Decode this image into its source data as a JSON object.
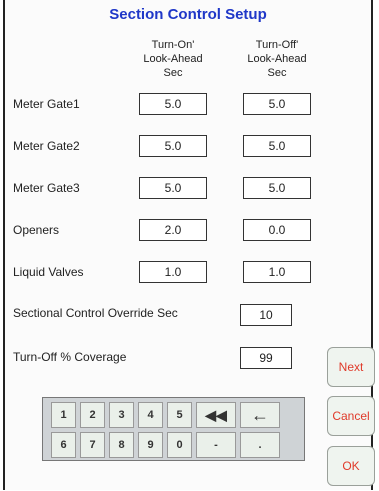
{
  "title": "Section Control Setup",
  "columns": {
    "turn_on": "Turn-On'\nLook-Ahead\nSec",
    "turn_off": "Turn-Off'\nLook-Ahead\nSec"
  },
  "rows": [
    {
      "label": "Meter Gate1",
      "on": "5.0",
      "off": "5.0"
    },
    {
      "label": "Meter Gate2",
      "on": "5.0",
      "off": "5.0"
    },
    {
      "label": "Meter Gate3",
      "on": "5.0",
      "off": "5.0"
    },
    {
      "label": "Openers",
      "on": "2.0",
      "off": "0.0"
    },
    {
      "label": "Liquid Valves",
      "on": "1.0",
      "off": "1.0"
    }
  ],
  "override": {
    "label": "Sectional Control Override Sec",
    "value": "10"
  },
  "coverage": {
    "label": "Turn-Off % Coverage",
    "value": "99"
  },
  "keypad": {
    "row1": [
      "1",
      "2",
      "3",
      "4",
      "5",
      "◀◀",
      "←"
    ],
    "row2": [
      "6",
      "7",
      "8",
      "9",
      "0",
      "-",
      "."
    ]
  },
  "buttons": {
    "next": "Next",
    "cancel": "Cancel",
    "ok": "OK"
  },
  "icons": {
    "backspace_all": "double-left-arrow-icon",
    "backspace": "left-arrow-icon"
  }
}
